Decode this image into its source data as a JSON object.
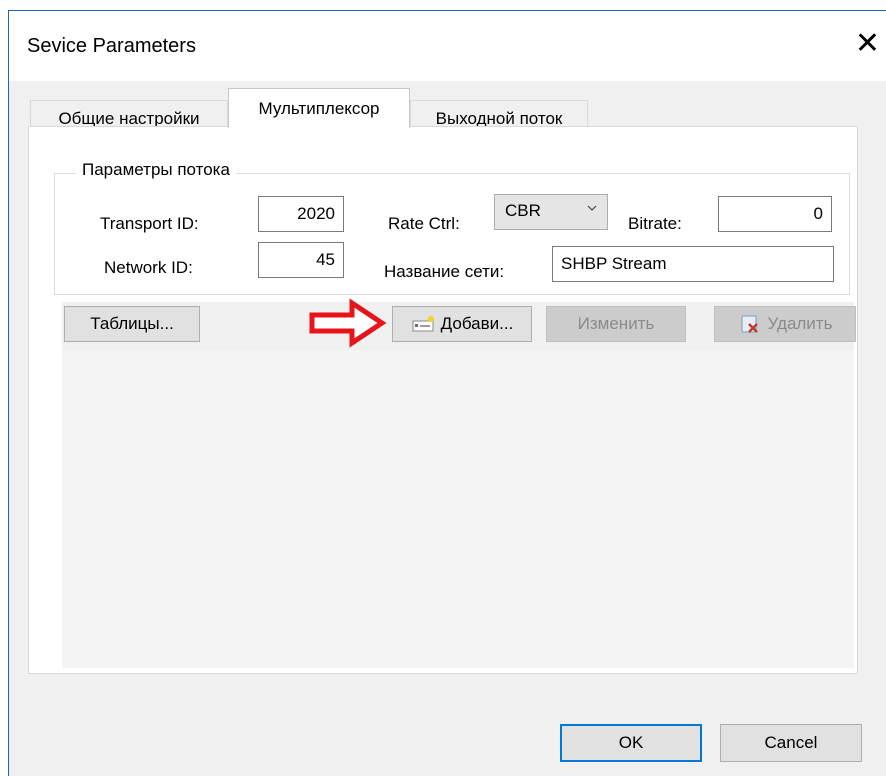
{
  "window": {
    "title": "Sevice Parameters"
  },
  "tabs": [
    {
      "label": "Общие настройки",
      "active": false
    },
    {
      "label": "Мультиплексор",
      "active": true
    },
    {
      "label": "Выходной поток",
      "active": false
    }
  ],
  "stream_params": {
    "group_title": "Параметры потока",
    "transport_id": {
      "label": "Transport ID:",
      "value": "2020"
    },
    "network_id": {
      "label": "Network ID:",
      "value": "45"
    },
    "rate_ctrl": {
      "label": "Rate Ctrl:",
      "selected": "CBR"
    },
    "bitrate": {
      "label": "Bitrate:",
      "value": "0"
    },
    "network_name": {
      "label": "Название сети:",
      "value": "SHBP Stream"
    }
  },
  "toolbar": {
    "tables_label": "Таблицы...",
    "add_label": "Добави...",
    "edit_label": "Изменить",
    "delete_label": "Удалить"
  },
  "footer": {
    "ok_label": "OK",
    "cancel_label": "Cancel"
  },
  "colors": {
    "window_border": "#1f63b4",
    "default_button_border": "#0078d7",
    "annotation_arrow": "#e8141b"
  }
}
